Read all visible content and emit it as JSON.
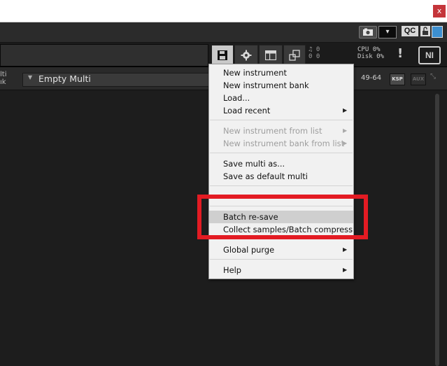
{
  "window": {
    "close_label": "x"
  },
  "toolbar": {
    "qc_label": "QC",
    "dropdown_arrow": "▾"
  },
  "header": {
    "midi_top": "♫ 0",
    "midi_bottom": "0 0",
    "cpu_label": "CPU",
    "cpu_value": "0%",
    "disk_label": "Disk",
    "disk_value": "0%",
    "warn_label": "!",
    "logo_label": "NI"
  },
  "rack": {
    "multi_label_line1": "lti",
    "multi_label_line2": "ık",
    "multi_name": "Empty Multi",
    "range_label": "49-64",
    "ksp_label": "KSP",
    "aux_label": "AUX",
    "expand_glyph": "⤡"
  },
  "menu": {
    "items": [
      {
        "label": "New instrument",
        "disabled": false,
        "submenu": false
      },
      {
        "label": "New instrument bank",
        "disabled": false,
        "submenu": false
      },
      {
        "label": "Load...",
        "disabled": false,
        "submenu": false
      },
      {
        "label": "Load recent",
        "disabled": false,
        "submenu": true
      },
      {
        "label": "New instrument from list",
        "disabled": true,
        "submenu": true
      },
      {
        "label": "New instrument bank from list",
        "disabled": true,
        "submenu": true
      },
      {
        "label": "Save multi as...",
        "disabled": false,
        "submenu": false
      },
      {
        "label": "Save as default multi",
        "disabled": false,
        "submenu": false
      },
      {
        "label": "Batch re-save",
        "disabled": false,
        "submenu": false,
        "highlighted": true
      },
      {
        "label": "Collect samples/Batch compress",
        "disabled": false,
        "submenu": false
      },
      {
        "label": "Global purge",
        "disabled": false,
        "submenu": true
      },
      {
        "label": "Help",
        "disabled": false,
        "submenu": true
      }
    ],
    "submenu_arrow": "▶"
  },
  "colors": {
    "background": "#1d1d1d",
    "menu_bg": "#f1f1f1",
    "highlight": "#cfcfcf",
    "annotation_red": "#e31b23",
    "close_red": "#c4353a",
    "accent_blue": "#3c8fd0"
  }
}
